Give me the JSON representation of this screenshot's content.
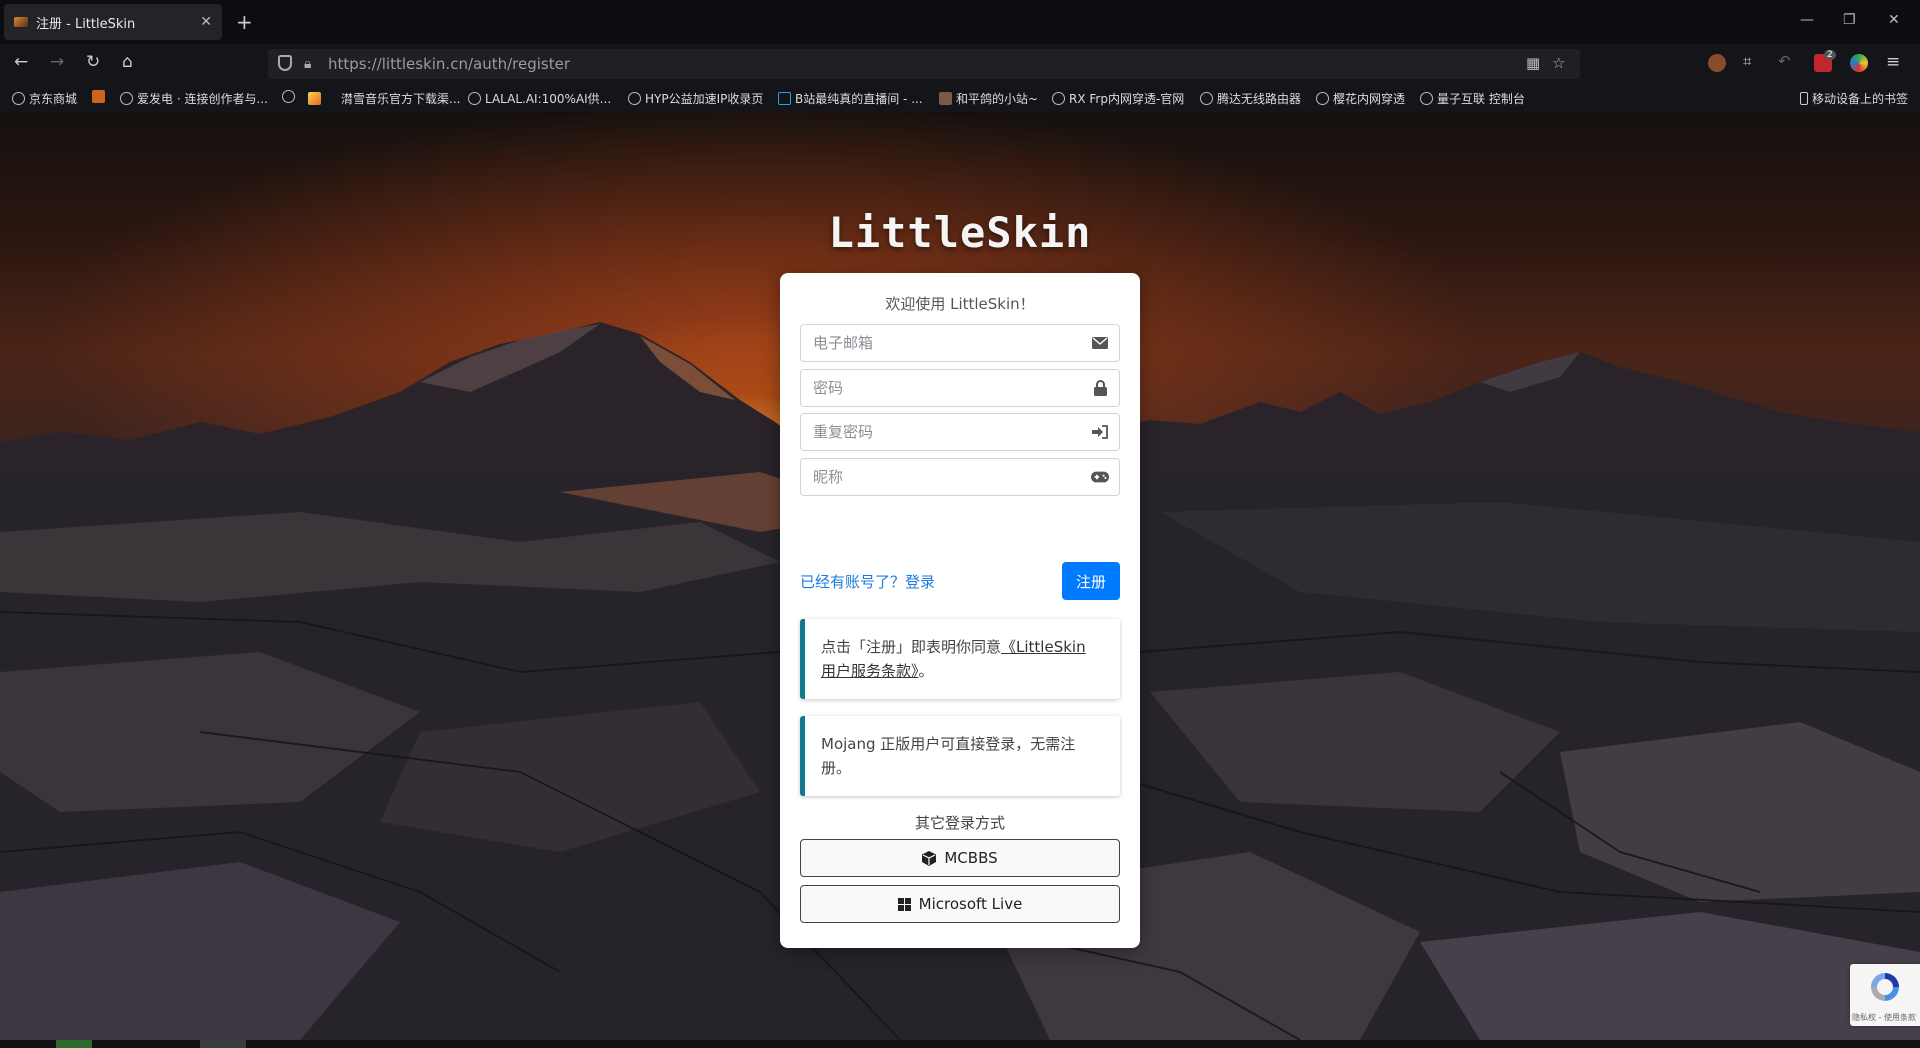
{
  "browser": {
    "tab_title": "注册 - LittleSkin",
    "new_tab": "+",
    "url": "https://littleskin.cn/auth/register",
    "extension_badge": "2"
  },
  "bookmarks": [
    {
      "label": "京东商城",
      "icon": "globe-icon"
    },
    {
      "label": "爱发电 · 连接创作者与...",
      "icon": "globe-icon"
    },
    {
      "label": "",
      "icon": "globe-icon"
    },
    {
      "label": "潸雪音乐官方下载渠...",
      "icon": "image-icon"
    },
    {
      "label": "LALAL.AI:100%AI供...",
      "icon": "globe-icon"
    },
    {
      "label": "HYP公益加速IP收录页",
      "icon": "globe-icon"
    },
    {
      "label": "B站最纯真的直播间 - ...",
      "icon": "bilibili-icon"
    },
    {
      "label": "和平鸽的小站~",
      "icon": "image-icon"
    },
    {
      "label": "RX Frp内网穿透-官网",
      "icon": "globe-icon"
    },
    {
      "label": "腾达无线路由器",
      "icon": "globe-icon"
    },
    {
      "label": "樱花内网穿透",
      "icon": "globe-icon"
    },
    {
      "label": "量子互联 控制台",
      "icon": "globe-icon"
    }
  ],
  "bookmarks_right": "移动设备上的书签",
  "page": {
    "brand": "LittleSkin",
    "welcome": "欢迎使用 LittleSkin！",
    "email_placeholder": "电子邮箱",
    "password_placeholder": "密码",
    "confirm_placeholder": "重复密码",
    "nickname_placeholder": "昵称",
    "login_link": "已经有账号了？登录",
    "register_button": "注册",
    "terms_prefix": "点击「注册」即表明你同意",
    "terms_link": "《LittleSkin 用户服务条款》",
    "terms_suffix": "。",
    "mojang_notice": "Mojang 正版用户可直接登录，无需注册。",
    "other_methods": "其它登录方式",
    "oauth": [
      {
        "label": "MCBBS",
        "icon": "cube-icon"
      },
      {
        "label": "Microsoft Live",
        "icon": "windows-icon"
      }
    ]
  },
  "recaptcha": {
    "footer": "隐私权 - 使用条款"
  },
  "colors": {
    "primary": "#007bff",
    "callout_border": "#117a8b",
    "link": "#1a7ddf"
  }
}
